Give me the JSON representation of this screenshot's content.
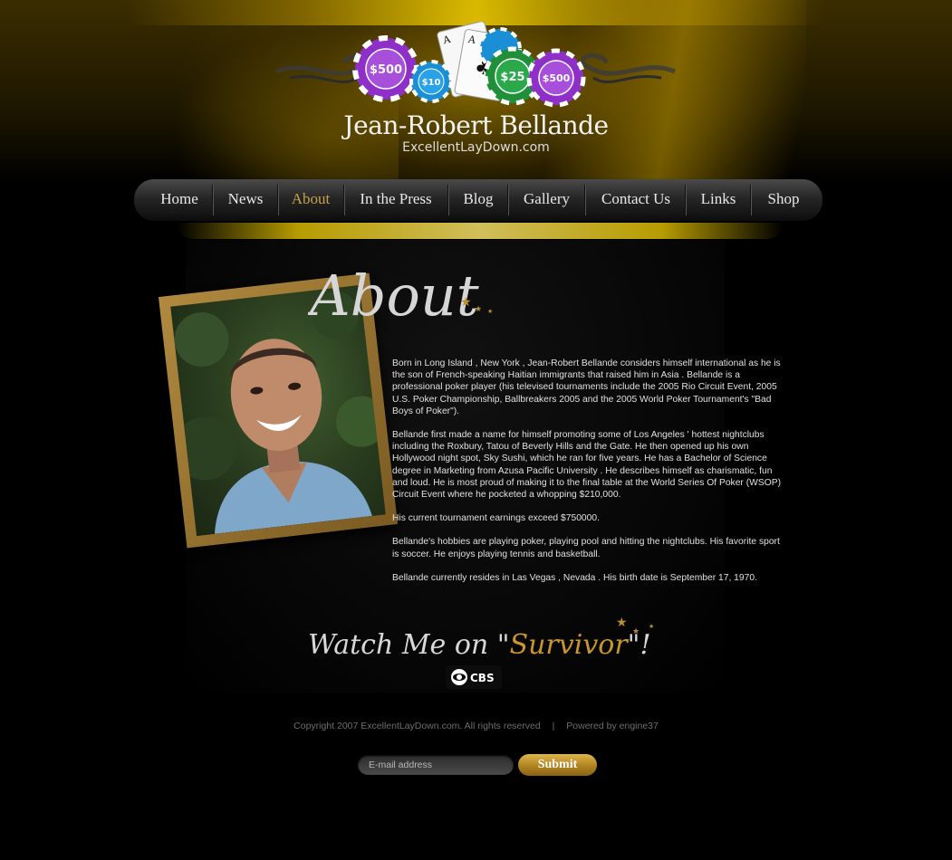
{
  "header": {
    "site_name": "Jean-Robert Bellande",
    "domain": "ExcellentLayDown.com",
    "chips": [
      "$500",
      "$10",
      "$25",
      "$500"
    ]
  },
  "nav": {
    "items": [
      {
        "label": "Home",
        "active": false
      },
      {
        "label": "News",
        "active": false
      },
      {
        "label": "About",
        "active": true
      },
      {
        "label": "In the Press",
        "active": false
      },
      {
        "label": "Blog",
        "active": false
      },
      {
        "label": "Gallery",
        "active": false
      },
      {
        "label": "Contact Us",
        "active": false
      },
      {
        "label": "Links",
        "active": false
      },
      {
        "label": "Shop",
        "active": false
      }
    ]
  },
  "about": {
    "heading": "About",
    "paragraphs": [
      "Born in Long Island , New York ,  Jean-Robert Bellande considers himself international as he is the son of French-speaking Haitian immigrants that raised him in Asia .  Bellande is a professional poker player (his televised tournaments include the 2005 Rio Circuit Event, 2005 U.S. Poker Championship, Ballbreakers 2005 and the 2005 World Poker Tournament's \"Bad Boys of Poker\").",
      "Bellande first made a name for himself promoting some of Los Angeles ' hottest nightclubs including the Roxbury, Tatou of Beverly Hills and the Gate.  He then opened up his own Hollywood night spot, Sky Sushi, which he ran for five years.  He has a Bachelor of Science degree in Marketing from Azusa Pacific University .  He describes himself as charismatic, fun and loud.  He is most proud of making it to the final table at the World Series Of Poker (WSOP) Circuit Event where he pocketed a whopping $210,000.",
      "His current tournament earnings exceed $750000.",
      "Bellande's hobbies are playing poker, playing pool and hitting the nightclubs.  His favorite sport is soccer.  He enjoys playing tennis and basketball.",
      "Bellande currently resides in Las Vegas , Nevada .  His birth date is September 17, 1970."
    ]
  },
  "survivor": {
    "part1": "Watch Me on \"",
    "part2": "Survivor",
    "part3": "\"!",
    "network": "CBS"
  },
  "footer": {
    "copyright": "Copyright 2007 ExcellentLayDown.com. All rights reserved",
    "separator": "|",
    "powered": "Powered by engine37",
    "email_placeholder": "E-mail address",
    "submit_label": "Submit"
  },
  "colors": {
    "accent_gold": "#c9a04a",
    "chip_purple": "#8e2fc7",
    "chip_blue": "#1a8fd6",
    "chip_green": "#1f8f3a"
  }
}
